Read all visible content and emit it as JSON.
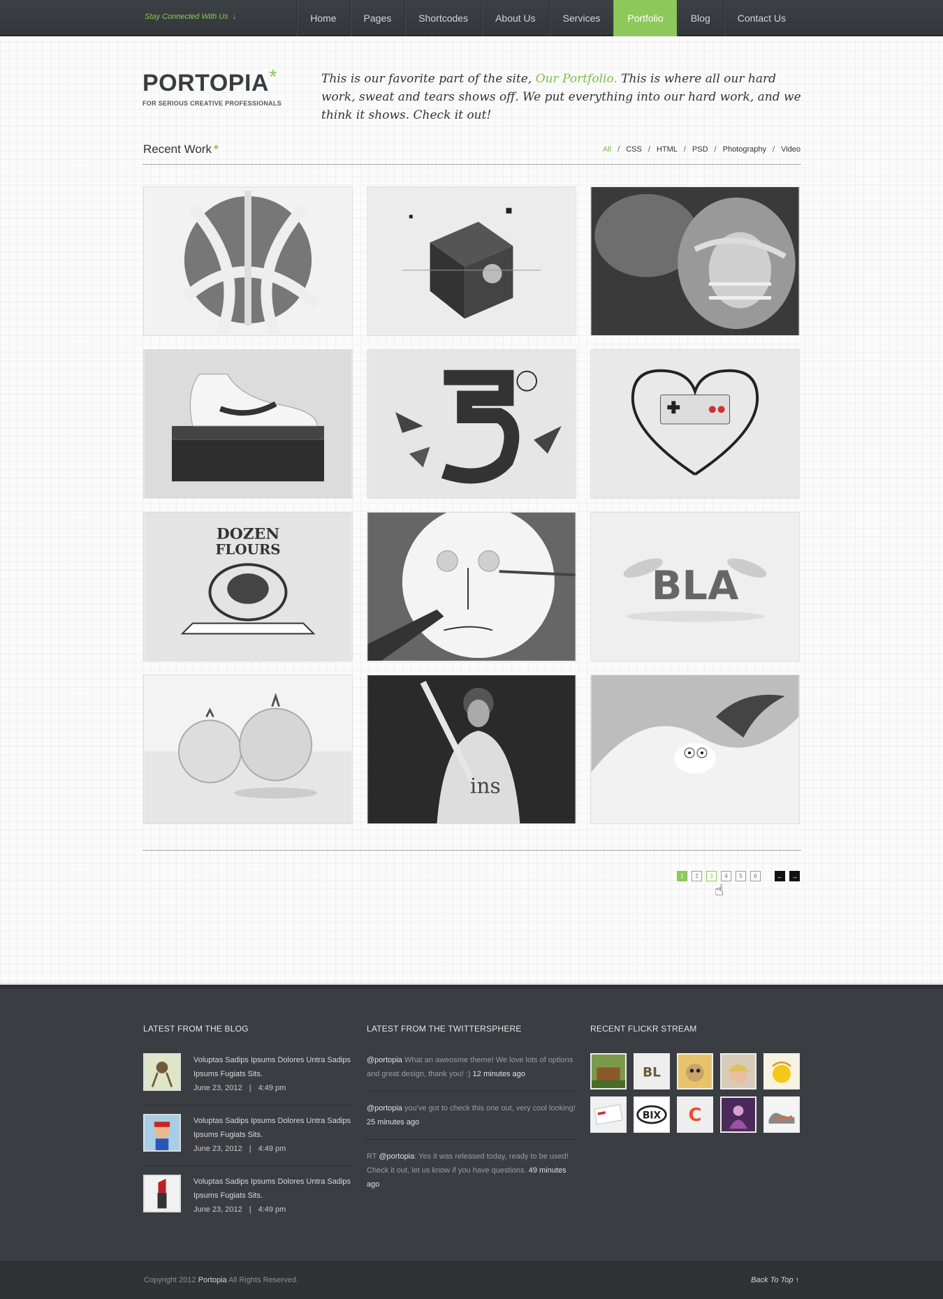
{
  "topbar": {
    "stay_label": "Stay Connected With Us",
    "stay_arrow": "↓",
    "nav": [
      "Home",
      "Pages",
      "Shortcodes",
      "About Us",
      "Services",
      "Portfolio",
      "Blog",
      "Contact Us"
    ],
    "active": "Portfolio"
  },
  "header": {
    "logo": "PORTOPIA",
    "logo_star": "*",
    "tagline": "FOR SERIOUS CREATIVE PROFESSIONALS",
    "intro_before": "This is our favorite part of the site, ",
    "intro_highlight": "Our Portfolio.",
    "intro_after": " This is where all our hard work, sweat and tears shows off.  We put everything into our hard work, and we think it shows.  Check it out!"
  },
  "recent_work": {
    "title": "Recent Work",
    "star": "*",
    "filters": [
      "All",
      "CSS",
      "HTML",
      "PSD",
      "Photography",
      "Video"
    ],
    "active_filter": "All",
    "items": [
      {
        "name": "roads-circle"
      },
      {
        "name": "abstract-cube"
      },
      {
        "name": "football-player"
      },
      {
        "name": "sneaker-box"
      },
      {
        "name": "shattered-letter"
      },
      {
        "name": "controller-heart"
      },
      {
        "name": "dozen-flours-logo"
      },
      {
        "name": "plate-face"
      },
      {
        "name": "fuzzy-bla"
      },
      {
        "name": "glass-tomatoes"
      },
      {
        "name": "baseball-player"
      },
      {
        "name": "milk-splash"
      }
    ]
  },
  "pagination": {
    "pages": [
      "1",
      "2",
      "3",
      "4",
      "5",
      "6"
    ],
    "current": "1",
    "hover": "3",
    "prev": "←",
    "next": "→"
  },
  "footer": {
    "blog": {
      "heading": "LATEST FROM THE BLOG",
      "posts": [
        {
          "title": "Voluptas Sadips Ipsums Dolores Untra Sadips Ipsums Fugiats Sits.",
          "date": "June 23, 2012",
          "sep": "|",
          "time": "4:49 pm"
        },
        {
          "title": "Voluptas Sadips Ipsums Dolores Untra Sadips Ipsums Fugiats Sits.",
          "date": "June 23, 2012",
          "sep": "|",
          "time": "4:49 pm"
        },
        {
          "title": "Voluptas Sadips Ipsums Dolores Untra Sadips Ipsums Fugiats Sits.",
          "date": "June 23, 2012",
          "sep": "|",
          "time": "4:49 pm"
        }
      ]
    },
    "twitter": {
      "heading": "LATEST FROM THE TWITTERSPHERE",
      "tweets": [
        {
          "prefix": "",
          "handle": "@portopia",
          "text": " What an aweosme theme!  We love lots of options and great design, thank you!  :) ",
          "ago": "12 minutes ago"
        },
        {
          "prefix": "",
          "handle": "@portopia",
          "text": " you've got to check this one out, very cool looking! ",
          "ago": "25 minutes ago"
        },
        {
          "prefix": "RT ",
          "handle": "@portopia",
          "text": ": Yes it was released today, ready to be used! Check it out, let us know if you have questions. ",
          "ago": "49 minutes ago"
        }
      ]
    },
    "flickr": {
      "heading": "RECENT FLICKR STREAM",
      "photos": [
        "tree-house",
        "fuzzy-bl",
        "pug-costume",
        "blond-boy",
        "lemon-splash",
        "business-card",
        "bix-logo",
        "c-logo",
        "purple-dancer",
        "nike-shoe"
      ]
    },
    "copyright_before": "Copyright 2012 ",
    "copyright_brand": "Portopia",
    "copyright_after": "  All Rights Reserved.",
    "back_to_top": "Back To Top",
    "back_to_top_arrow": "↑"
  },
  "colors": {
    "accent": "#8cc85a",
    "dark": "#3a3e42",
    "nav": "#393d41"
  }
}
